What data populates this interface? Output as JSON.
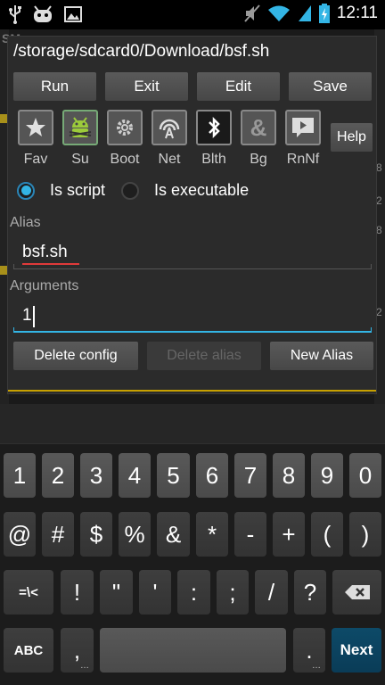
{
  "status_bar": {
    "time": "12:11",
    "icons": [
      "usb-icon",
      "android-debug-icon",
      "image-icon",
      "mute-icon",
      "wifi-icon",
      "signal-icon",
      "battery-charging-icon"
    ]
  },
  "background_app": {
    "title": "SM",
    "edge_chars": [
      "8",
      "2",
      "8",
      "2"
    ]
  },
  "dialog": {
    "title": "/storage/sdcard0/Download/bsf.sh",
    "actions": [
      "Run",
      "Exit",
      "Edit",
      "Save"
    ],
    "options": [
      {
        "label": "Fav",
        "icon": "star-icon"
      },
      {
        "label": "Su",
        "icon": "android-root-icon"
      },
      {
        "label": "Boot",
        "icon": "gear-icon"
      },
      {
        "label": "Net",
        "icon": "network-icon"
      },
      {
        "label": "Blth",
        "icon": "bluetooth-icon"
      },
      {
        "label": "Bg",
        "icon": "ampersand-icon"
      },
      {
        "label": "RnNf",
        "icon": "notification-icon"
      }
    ],
    "help_label": "Help",
    "radio_script_label": "Is script",
    "radio_exec_label": "Is executable",
    "selected_radio": "Is script",
    "alias_label": "Alias",
    "alias_value": "bsf.sh",
    "arguments_label": "Arguments",
    "arguments_value": "1",
    "delete_config_label": "Delete config",
    "delete_alias_label": "Delete alias",
    "new_alias_label": "New Alias"
  },
  "keyboard": {
    "row1": [
      "1",
      "2",
      "3",
      "4",
      "5",
      "6",
      "7",
      "8",
      "9",
      "0"
    ],
    "row2": [
      "@",
      "#",
      "$",
      "%",
      "&",
      "*",
      "-",
      "+",
      "(",
      ")"
    ],
    "row3": [
      "=\\<",
      "!",
      "\"",
      "'",
      ":",
      ";",
      "/",
      "?"
    ],
    "abc_label": "ABC",
    "comma": ",",
    "period": ".",
    "next_label": "Next",
    "backspace_icon": "backspace-icon"
  },
  "colors": {
    "accent": "#33b5e5",
    "dialog_divider": "#c7a000",
    "spell_error": "#e03a3a",
    "next_key": "#0a3c57"
  }
}
